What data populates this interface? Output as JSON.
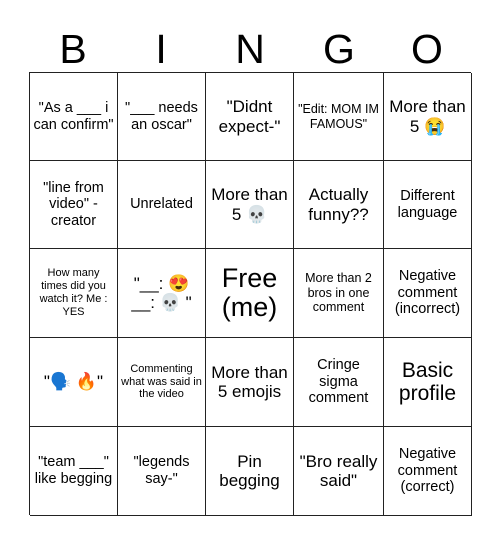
{
  "card": {
    "header_letters": [
      "B",
      "I",
      "N",
      "G",
      "O"
    ],
    "columns": 5,
    "rows": 5,
    "border_color": "#222222",
    "background_color": "#ffffff",
    "text_color": "#000000"
  },
  "cells": [
    {
      "id": "b1",
      "text": "\"As a ___ i can confirm\"",
      "size": "md"
    },
    {
      "id": "i1",
      "text": "\"___ needs an oscar\"",
      "size": "md"
    },
    {
      "id": "n1",
      "text": "\"Didnt expect-\"",
      "size": "lg"
    },
    {
      "id": "g1",
      "text": "\"Edit: MOM IM FAMOUS\"",
      "size": "sm"
    },
    {
      "id": "o1",
      "text": "More than 5 😭",
      "size": "lg"
    },
    {
      "id": "b2",
      "text": "\"line from video\" -creator",
      "size": "md"
    },
    {
      "id": "i2",
      "text": "Unrelated",
      "size": "md"
    },
    {
      "id": "n2",
      "text": "More than 5 💀",
      "size": "lg"
    },
    {
      "id": "g2",
      "text": "Actually funny??",
      "size": "lg"
    },
    {
      "id": "o2",
      "text": "Different language",
      "size": "md"
    },
    {
      "id": "b3",
      "text": "How many times did you watch it? Me : YES",
      "size": "xs"
    },
    {
      "id": "i3",
      "text": "\"__: 😍 __: 💀 \"",
      "size": "lg"
    },
    {
      "id": "n3",
      "text": "Free (me)",
      "size": "xxl"
    },
    {
      "id": "g3",
      "text": "More than 2 bros in one comment",
      "size": "sm"
    },
    {
      "id": "o3",
      "text": "Negative comment (incorrect)",
      "size": "md"
    },
    {
      "id": "b4",
      "text": "\"🗣️ 🔥\"",
      "size": "lg"
    },
    {
      "id": "i4",
      "text": "Commenting what was said in the video",
      "size": "xs"
    },
    {
      "id": "n4",
      "text": "More than 5 emojis",
      "size": "lg"
    },
    {
      "id": "g4",
      "text": "Cringe sigma comment",
      "size": "md"
    },
    {
      "id": "o4",
      "text": "Basic profile",
      "size": "xl"
    },
    {
      "id": "b5",
      "text": "\"team ___\" like begging",
      "size": "md"
    },
    {
      "id": "i5",
      "text": "\"legends say-\"",
      "size": "md"
    },
    {
      "id": "n5",
      "text": "Pin begging",
      "size": "lg"
    },
    {
      "id": "g5",
      "text": "\"Bro really said\"",
      "size": "lg"
    },
    {
      "id": "o5",
      "text": "Negative comment (correct)",
      "size": "md"
    }
  ]
}
